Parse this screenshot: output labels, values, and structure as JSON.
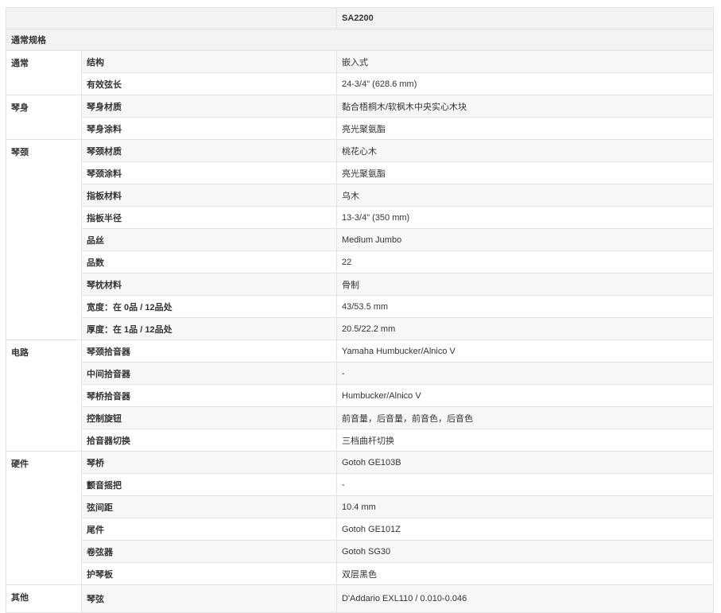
{
  "header": {
    "model": "SA2200"
  },
  "section_title": "通常规格",
  "groups": [
    {
      "category": "通常",
      "rows": [
        {
          "item": "结构",
          "value": "嵌入式"
        },
        {
          "item": "有效弦长",
          "value": "24-3/4\" (628.6 mm)"
        }
      ]
    },
    {
      "category": "琴身",
      "rows": [
        {
          "item": "琴身材质",
          "value": "黏合梧桐木/软枫木中央实心木块"
        },
        {
          "item": "琴身涂料",
          "value": "亮光聚氨酯"
        }
      ]
    },
    {
      "category": "琴颈",
      "rows": [
        {
          "item": "琴颈材质",
          "value": "桃花心木"
        },
        {
          "item": "琴颈涂料",
          "value": "亮光聚氨酯"
        },
        {
          "item": "指板材料",
          "value": "乌木"
        },
        {
          "item": "指板半径",
          "value": "13-3/4\" (350 mm)"
        },
        {
          "item": "品丝",
          "value": "Medium Jumbo"
        },
        {
          "item": "品数",
          "value": "22"
        },
        {
          "item": "琴枕材料",
          "value": "骨制"
        },
        {
          "item": "宽度：在 0品 / 12品处",
          "value": "43/53.5 mm"
        },
        {
          "item": "厚度：在 1品 / 12品处",
          "value": "20.5/22.2 mm"
        }
      ]
    },
    {
      "category": "电路",
      "rows": [
        {
          "item": "琴颈拾音器",
          "value": "Yamaha Humbucker/Alnico V"
        },
        {
          "item": "中间拾音器",
          "value": "-"
        },
        {
          "item": "琴桥拾音器",
          "value": "Humbucker/Alnico V"
        },
        {
          "item": "控制旋钮",
          "value": "前音量，后音量，前音色，后音色"
        },
        {
          "item": "拾音器切换",
          "value": "三档曲杆切换"
        }
      ]
    },
    {
      "category": "硬件",
      "rows": [
        {
          "item": "琴桥",
          "value": "Gotoh GE103B"
        },
        {
          "item": "颤音摇把",
          "value": "-"
        },
        {
          "item": "弦间距",
          "value": "10.4 mm"
        },
        {
          "item": "尾件",
          "value": "Gotoh GE101Z"
        },
        {
          "item": "卷弦器",
          "value": "Gotoh SG30"
        },
        {
          "item": "护琴板",
          "value": "双层黑色"
        }
      ]
    },
    {
      "category": "其他",
      "rows": [
        {
          "item": "琴弦",
          "value": "D'Addario EXL110 / 0.010-0.046"
        }
      ]
    }
  ]
}
